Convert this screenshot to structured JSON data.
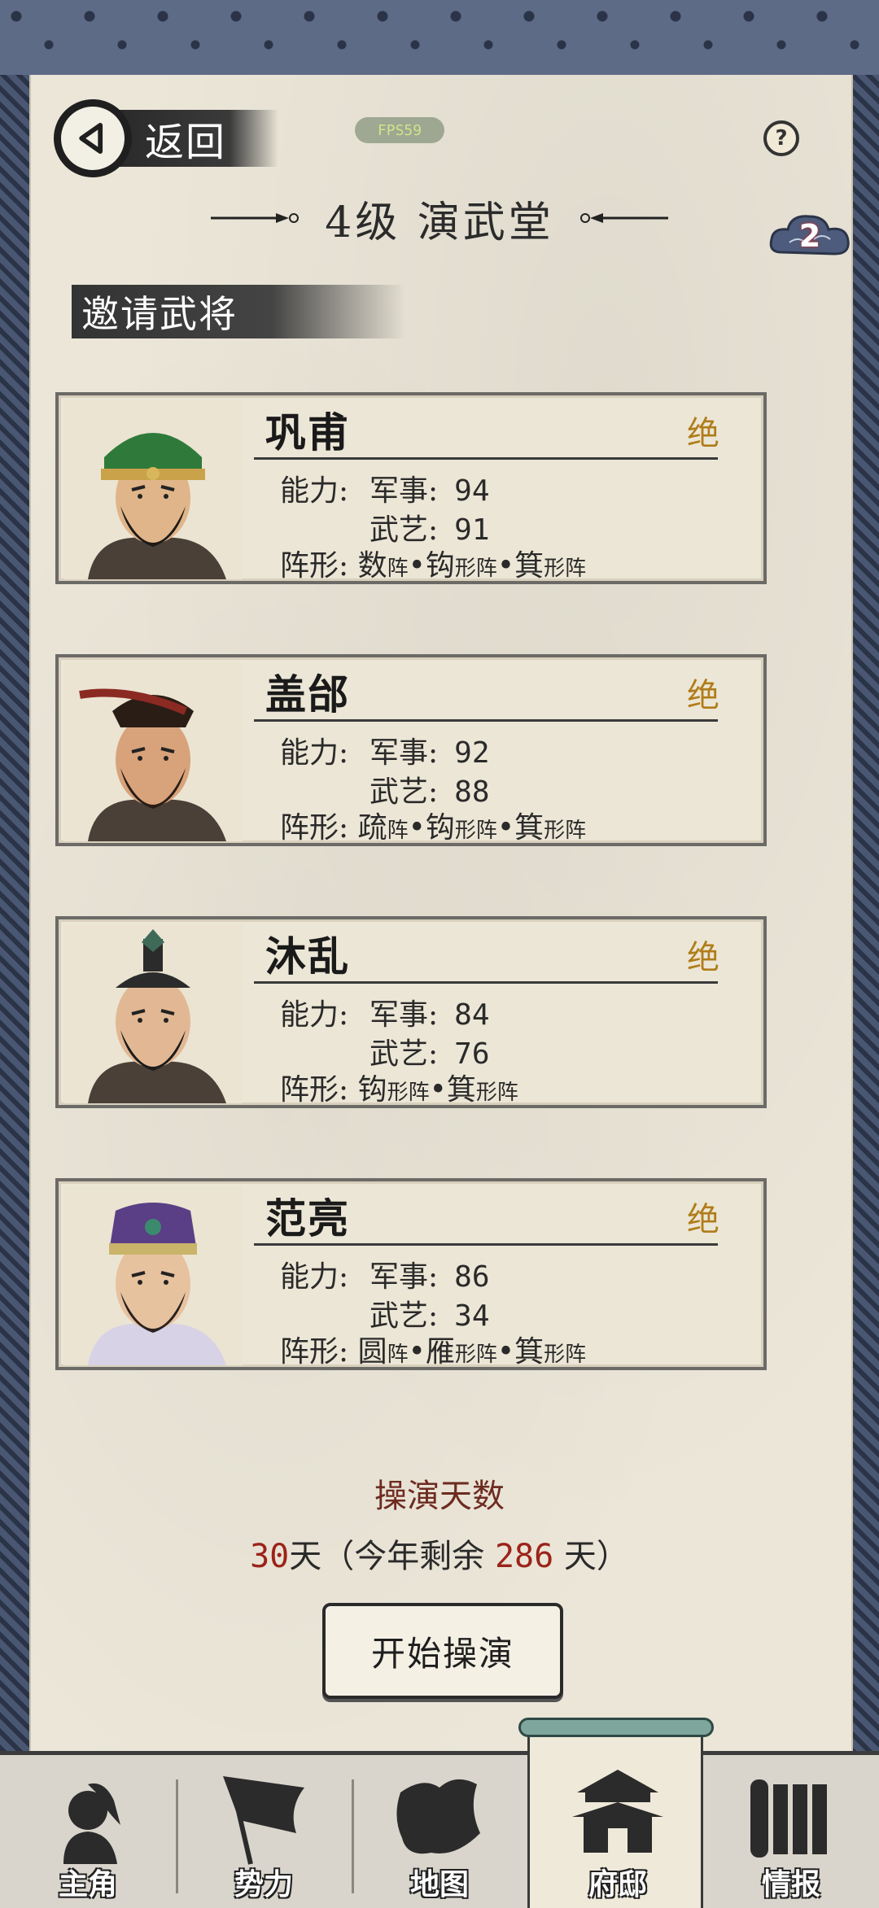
{
  "header": {
    "back_label": "返回",
    "fps_badge": "FPS59",
    "help_symbol": "?",
    "title": "4级 演武堂",
    "cloud_badge_count": "2"
  },
  "section": {
    "title": "邀请武将"
  },
  "generals": [
    {
      "name": "巩甫",
      "rank": "绝",
      "ability_label": "能力:",
      "military_label": "军事:",
      "military": "94",
      "martial_label": "武艺:",
      "martial": "91",
      "formation_label": "阵形:",
      "formation": [
        [
          "数",
          "阵"
        ],
        [
          "钩",
          "形阵"
        ],
        [
          "箕",
          "形阵"
        ]
      ],
      "portrait_colors": {
        "hat": "#2f7a3a",
        "skin": "#e0b58a",
        "beard": "#1e1a16"
      }
    },
    {
      "name": "盖邰",
      "rank": "绝",
      "ability_label": "能力:",
      "military_label": "军事:",
      "military": "92",
      "martial_label": "武艺:",
      "martial": "88",
      "formation_label": "阵形:",
      "formation": [
        [
          "疏",
          "阵"
        ],
        [
          "钩",
          "形阵"
        ],
        [
          "箕",
          "形阵"
        ]
      ],
      "portrait_colors": {
        "hat": "#8b2a22",
        "skin": "#d8a27a",
        "beard": "#2a1d16"
      }
    },
    {
      "name": "沐乱",
      "rank": "绝",
      "ability_label": "能力:",
      "military_label": "军事:",
      "military": "84",
      "martial_label": "武艺:",
      "martial": "76",
      "formation_label": "阵形:",
      "formation": [
        [
          "钩",
          "形阵"
        ],
        [
          "箕",
          "形阵"
        ]
      ],
      "portrait_colors": {
        "hat": "#2b2b2b",
        "skin": "#e2b894",
        "beard": "#1b1b1b"
      }
    },
    {
      "name": "范亮",
      "rank": "绝",
      "ability_label": "能力:",
      "military_label": "军事:",
      "military": "86",
      "martial_label": "武艺:",
      "martial": "34",
      "formation_label": "阵形:",
      "formation": [
        [
          "圆",
          "阵"
        ],
        [
          "雁",
          "形阵"
        ],
        [
          "箕",
          "形阵"
        ]
      ],
      "portrait_colors": {
        "hat": "#5a3f86",
        "skin": "#e7c29f",
        "beard": "#2a2320"
      }
    }
  ],
  "drill": {
    "label": "操演天数",
    "days": "30",
    "days_unit": "天",
    "remain_prefix": "（今年剩余",
    "remain": "286",
    "remain_suffix": "天）",
    "start_button": "开始操演"
  },
  "nav": {
    "items": [
      {
        "label": "主角",
        "icon": "character-icon",
        "active": false
      },
      {
        "label": "势力",
        "icon": "flag-icon",
        "active": false
      },
      {
        "label": "地图",
        "icon": "map-icon",
        "active": false
      },
      {
        "label": "府邸",
        "icon": "mansion-icon",
        "active": true
      },
      {
        "label": "情报",
        "icon": "scroll-icon",
        "active": false
      }
    ]
  },
  "colors": {
    "rank": "#b07d1a",
    "highlight_red": "#9b2318",
    "paper": "#ebe6d8",
    "frame": "#3a4660"
  }
}
